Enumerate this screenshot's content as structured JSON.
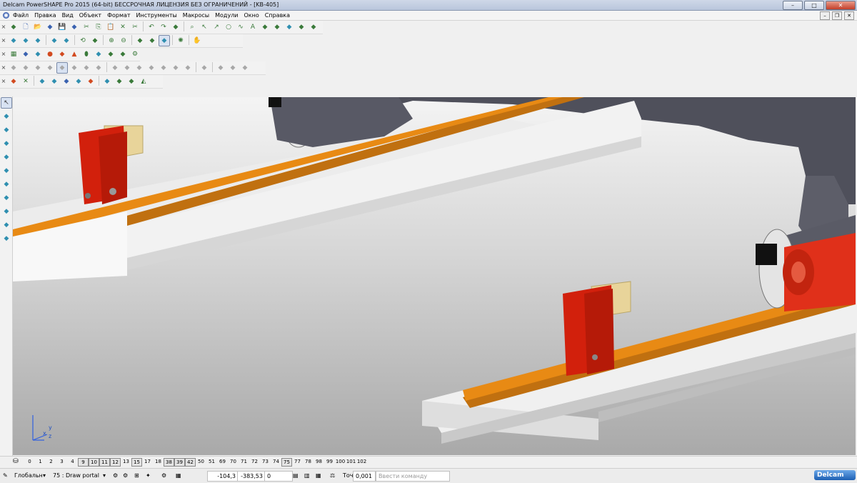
{
  "window": {
    "title": "Delcam PowerSHAPE Pro 2015 (64-bit) БЕССРОЧНАЯ ЛИЦЕНЗИЯ БЕЗ ОГРАНИЧЕНИЙ - [KB-405]",
    "minimize": "–",
    "maximize": "□",
    "close": "✕"
  },
  "menu": {
    "items": [
      "Файл",
      "Правка",
      "Вид",
      "Объект",
      "Формат",
      "Инструменты",
      "Макросы",
      "Модули",
      "Окно",
      "Справка"
    ],
    "mdi": [
      "–",
      "❐",
      "✕"
    ]
  },
  "toolbars": [
    {
      "icons": [
        "wand-icon",
        "new-file-icon",
        "open-folder-icon",
        "open-model-icon",
        "save-icon",
        "save-as-icon",
        "cut-icon",
        "copy-icon",
        "paste-icon",
        "delete-icon",
        "scissors-icon",
        "sep",
        "undo-icon",
        "redo-icon",
        "sketch-icon",
        "sep",
        "find-icon",
        "select-icon",
        "pointer-icon",
        "circle-icon",
        "curve-icon",
        "text-icon",
        "shade-icon",
        "view-icon",
        "layer-icon",
        "measure-icon",
        "tools-icon"
      ]
    },
    {
      "icons": [
        "box-view-icon",
        "box-view2-icon",
        "box-view3-icon",
        "sep",
        "cube-iso-icon",
        "cube-front-icon",
        "sep",
        "rotate-icon",
        "zoom-icon",
        "sep",
        "zoom-in-icon",
        "zoom-out-icon",
        "sep",
        "zoom-window-icon",
        "zoom-all-icon",
        "shaded-icon",
        "sep",
        "lightbulb-icon",
        "sep",
        "pan-icon"
      ]
    },
    {
      "icons": [
        "grid-icon",
        "doc-icon",
        "solid-icon",
        "sphere-icon",
        "color-icon",
        "cone-icon",
        "cylinder-icon",
        "assembly-icon",
        "frame-icon",
        "export-icon",
        "gear-icon"
      ]
    },
    {
      "icons": [
        "surf1-icon",
        "surf2-icon",
        "surf3-icon",
        "surf4-icon",
        "surf5-icon",
        "surf6-icon",
        "surf7-icon",
        "surf8-icon",
        "sep",
        "surf9-icon",
        "surf10-icon",
        "surf11-icon",
        "surf12-icon",
        "surf13-icon",
        "surf14-icon",
        "surf15-icon",
        "sep",
        "surf16-icon",
        "sep",
        "surf17-icon",
        "surf18-icon",
        "surf19-icon"
      ]
    },
    {
      "icons": [
        "sphere2-icon",
        "axis-icon",
        "sep",
        "solid2-icon",
        "mesh-icon",
        "sheet-icon",
        "layer2-icon",
        "part-icon",
        "sep",
        "feature-icon",
        "tree-icon",
        "hole-icon",
        "pyramid-icon"
      ]
    }
  ],
  "side_toolbar": {
    "icons": [
      "arrow-select-icon",
      "workplane-icon",
      "solid-side-icon",
      "surface-side-icon",
      "curve-side-icon",
      "wire-side-icon",
      "shape-side-icon",
      "cylinder-side-icon",
      "torus-side-icon",
      "sheet-side-icon",
      "group-side-icon"
    ]
  },
  "viewport": {
    "axis": {
      "x": "x",
      "y": "y",
      "z": "z"
    }
  },
  "levels": {
    "items": [
      "0",
      "1",
      "2",
      "3",
      "4",
      "9",
      "10",
      "11",
      "12",
      "13",
      "15",
      "17",
      "18",
      "38",
      "39",
      "42",
      "50",
      "51",
      "69",
      "70",
      "71",
      "72",
      "73",
      "74",
      "75",
      "77",
      "78",
      "98",
      "99",
      "100",
      "101",
      "102"
    ],
    "active": [
      "9",
      "10",
      "11",
      "12",
      "15",
      "38",
      "39",
      "42",
      "75"
    ]
  },
  "status": {
    "workplane": "Глобальн",
    "level_selector": "75 : Draw portal",
    "x": "-104,3",
    "y": "-383,53",
    "z": "0",
    "tol_label": "Точ",
    "tol": "0,001",
    "command_placeholder": "Ввести команду",
    "brand": "Delcam"
  },
  "colors": {
    "rail": "#e88a14",
    "bracket": "#d2200c",
    "motor": "#e0301a",
    "block": "#e8d49a",
    "frame": "#5a5b66"
  }
}
